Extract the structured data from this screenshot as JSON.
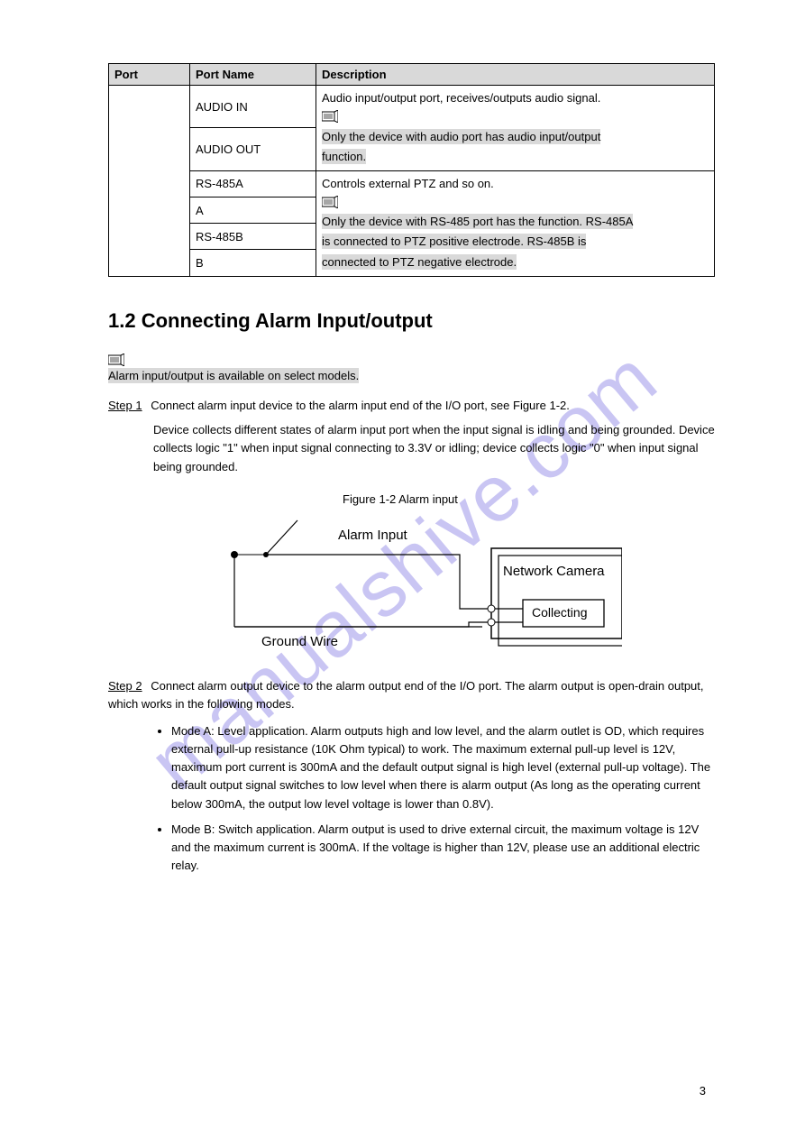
{
  "table": {
    "headers": [
      "Port",
      "Port Name",
      "Description"
    ],
    "col1_empty": "",
    "rows_col2": [
      "AUDIO IN",
      "AUDIO OUT",
      "RS-485A",
      "A",
      "RS-485B",
      "B"
    ],
    "cell_audio_combined": {
      "line1": "Audio input/output port, receives/outputs audio signal.",
      "note_hl_1": "Only the device with audio port has audio input/output",
      "note_hl_2": "function."
    },
    "cell_rs485_combined": {
      "line1": "Controls external PTZ and so on.",
      "note_hl_1": "Only the device with RS-485 port has the function. RS-485A",
      "note_hl_2": "is connected to PTZ positive electrode. RS-485B is",
      "note_hl_3": "connected to PTZ negative electrode."
    }
  },
  "section": {
    "number": "1.2",
    "title": "Connecting Alarm Input/output"
  },
  "note_section": "Alarm input/output is available on select models.",
  "step1_label": "Step 1",
  "step1_text": "Connect alarm input device to the alarm input end of the I/O port, see Figure 1-2.",
  "step1_para": "Device collects different states of alarm input port when the input signal is idling and being grounded. Device collects logic \"1\" when input signal connecting to 3.3V or idling; device collects logic \"0\" when input signal being grounded.",
  "fig1_caption": "Figure 1-2 Alarm input",
  "diagram": {
    "alarm_input": "Alarm Input",
    "ground_wire": "Ground Wire",
    "network_camera": "Network Camera",
    "collecting": "Collecting"
  },
  "step2_label": "Step 2",
  "step2_text": "Connect alarm output device to the alarm output end of the I/O port. The alarm output is open-drain output, which works in the following modes.",
  "bullet1": "Mode A: Level application. Alarm outputs high and low level, and the alarm outlet is OD, which requires external pull-up resistance (10K Ohm typical) to work. The maximum external pull-up level is 12V, maximum port current is 300mA and the default output signal is high level (external pull-up voltage). The default output signal switches to low level when there is alarm output (As long as the operating current below 300mA, the output low level voltage is lower than 0.8V).",
  "bullet2": "Mode B: Switch application. Alarm output is used to drive external circuit, the maximum voltage is 12V and the maximum current is 300mA. If the voltage is higher than 12V, please use an additional electric relay.",
  "page_number": "3",
  "watermark": "manualshive.com"
}
